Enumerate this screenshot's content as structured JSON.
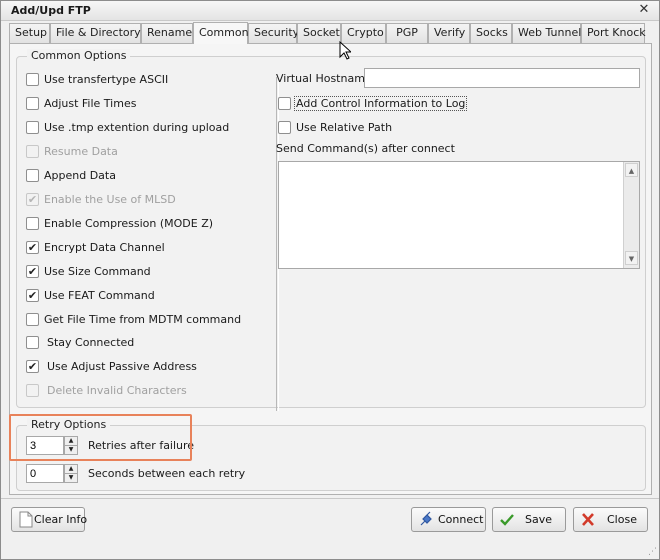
{
  "window": {
    "title": "Add/Upd FTP",
    "close_glyph": "✕"
  },
  "tabs": [
    {
      "label": "Setup"
    },
    {
      "label": "File & Directory"
    },
    {
      "label": "Rename"
    },
    {
      "label": "Common",
      "active": true
    },
    {
      "label": "Security"
    },
    {
      "label": "Socket"
    },
    {
      "label": "Crypto"
    },
    {
      "label": "PGP"
    },
    {
      "label": "Verify"
    },
    {
      "label": "Socks"
    },
    {
      "label": "Web Tunnel"
    },
    {
      "label": "Port Knock"
    }
  ],
  "common_options": {
    "legend": "Common Options",
    "items": [
      {
        "label": "Use transfertype ASCII",
        "checked": false,
        "disabled": false
      },
      {
        "label": "Adjust File Times",
        "checked": false,
        "disabled": false
      },
      {
        "label": "Use .tmp extention during upload",
        "checked": false,
        "disabled": false
      },
      {
        "label": "Resume Data",
        "checked": false,
        "disabled": true
      },
      {
        "label": "Append Data",
        "checked": false,
        "disabled": false
      },
      {
        "label": "Enable the Use of MLSD",
        "checked": true,
        "disabled": true
      },
      {
        "label": "Enable Compression (MODE Z)",
        "checked": false,
        "disabled": false
      },
      {
        "label": "Encrypt Data Channel",
        "checked": true,
        "disabled": false
      },
      {
        "label": "Use Size Command",
        "checked": true,
        "disabled": false
      },
      {
        "label": "Use FEAT Command",
        "checked": true,
        "disabled": false
      },
      {
        "label": "Get File Time from MDTM command",
        "checked": false,
        "disabled": false
      },
      {
        "label": "Stay Connected",
        "checked": false,
        "disabled": false
      },
      {
        "label": "Use Adjust Passive Address",
        "checked": true,
        "disabled": false
      },
      {
        "label": "Delete Invalid Characters",
        "checked": false,
        "disabled": true
      }
    ],
    "virtual_hostname_label": "Virtual Hostname",
    "virtual_hostname_value": "",
    "add_control_info_label": "Add Control Information to Log",
    "add_control_info_checked": false,
    "use_relative_path_label": "Use Relative Path",
    "use_relative_path_checked": false,
    "send_commands_label": "Send Command(s) after connect",
    "send_commands_value": ""
  },
  "retry_options": {
    "legend": "Retry Options",
    "retries_value": "3",
    "retries_label": "Retries after failure",
    "seconds_value": "0",
    "seconds_label": "Seconds between each retry",
    "highlight_color": "#e8825a"
  },
  "footer": {
    "clear_info_label": "Clear Info",
    "connect_label": "Connect",
    "save_label": "Save",
    "close_label": "Close"
  },
  "icons": {
    "check_glyph": "✔",
    "spin_up": "▲",
    "spin_down": "▼",
    "scroll_up": "▲",
    "scroll_down": "▼",
    "grip_glyph": "⋰"
  },
  "colors": {
    "save_check": "#3a9a2a",
    "close_x": "#d23a2a",
    "connect_plug": "#4a78c8"
  }
}
